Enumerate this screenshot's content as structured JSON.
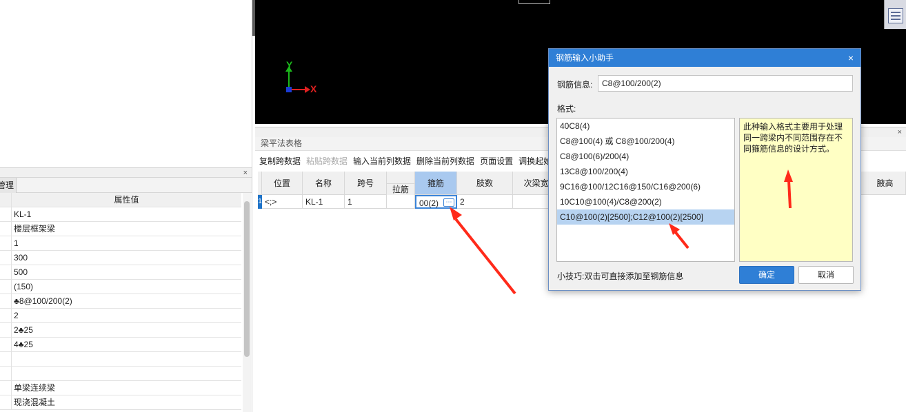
{
  "left_panel": {
    "tab_label": "管理",
    "column_header": "属性值",
    "rows": [
      "KL-1",
      "楼层框架梁",
      "1",
      "300",
      "500",
      "(150)",
      "♣8@100/200(2)",
      "2",
      "2♣25",
      "4♣25",
      "",
      "",
      "单梁连续梁",
      "现浇混凝土"
    ]
  },
  "beam_table": {
    "title": "梁平法表格",
    "toolbar": {
      "copy_span": "复制跨数据",
      "paste_span": "粘贴跨数据",
      "input_column": "输入当前列数据",
      "delete_column": "删除当前列数据",
      "page_setup": "页面设置",
      "adjust_start": "调换起始"
    },
    "headers": {
      "position": "位置",
      "name": "名称",
      "span_no": "跨号",
      "tie_bar": "拉筋",
      "stirrup": "箍筋",
      "legs": "肢数",
      "sub_beam_width": "次梁宽",
      "haunch_height": "腋高"
    },
    "row": {
      "index": "1",
      "position": "<;>",
      "name": "KL-1",
      "span_no": "1",
      "tie_bar": "",
      "stirrup": "00(2)",
      "legs": "2",
      "more_button": "⋯"
    }
  },
  "dialog": {
    "title": "钢筋输入小助手",
    "close": "×",
    "info_label": "钢筋信息:",
    "info_value": "C8@100/200(2)",
    "format_label": "格式:",
    "formats": [
      "40C8(4)",
      "C8@100(4) 或 C8@100/200(4)",
      "C8@100(6)/200(4)",
      "13C8@100/200(4)",
      "9C16@100/12C16@150/C16@200(6)",
      "10C10@100(4)/C8@200(2)",
      "C10@100(2)[2500];C12@100(2)[2500]"
    ],
    "selected_format_index": 6,
    "tip_text": "此种输入格式主要用于处理同一跨梁内不同范围存在不同箍筋信息的设计方式。",
    "hint": "小技巧:双击可直接添加至钢筋信息",
    "ok_label": "确定",
    "cancel_label": "取消"
  },
  "canvas": {
    "axis_x": "X",
    "axis_y": "Y"
  },
  "colors": {
    "accent": "#2f7fd6",
    "selection": "#b7d3f1",
    "tip_background": "#ffffc4",
    "annotation_arrow": "#ff2a1a"
  }
}
